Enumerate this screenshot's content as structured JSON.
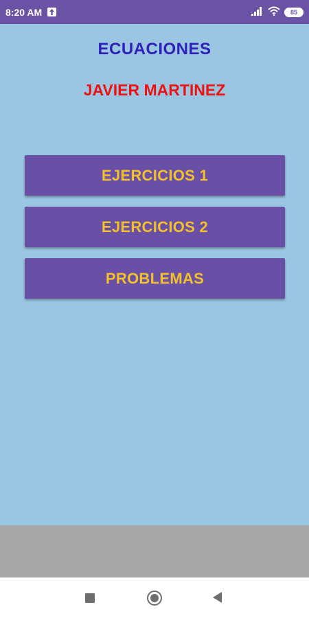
{
  "status_bar": {
    "time": "8:20 AM",
    "battery": "85"
  },
  "header": {
    "title": "ECUACIONES",
    "author": "JAVIER MARTINEZ"
  },
  "menu": {
    "buttons": [
      {
        "label": "EJERCICIOS 1"
      },
      {
        "label": "EJERCICIOS 2"
      },
      {
        "label": "PROBLEMAS"
      }
    ]
  },
  "colors": {
    "background": "#9ac6e4",
    "status_bar": "#6a52a4",
    "button": "#6a4fa6",
    "button_text": "#f2c12a",
    "title": "#2f21b8",
    "author": "#ee1111"
  },
  "icons": {
    "upload": "upload-icon",
    "signal": "signal-icon",
    "wifi": "wifi-icon",
    "battery": "battery-icon",
    "recent": "recent-apps-icon",
    "home": "home-icon",
    "back": "back-icon"
  }
}
